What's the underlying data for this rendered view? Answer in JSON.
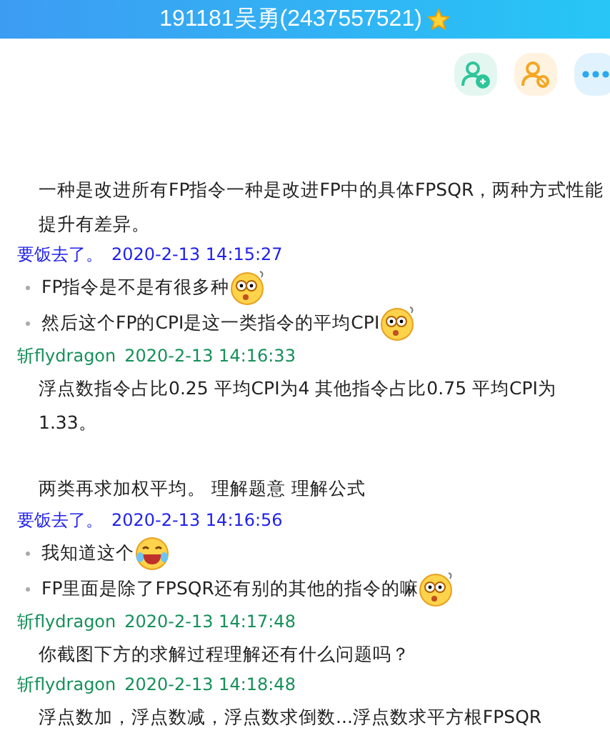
{
  "window": {
    "title": "191181吴勇(2437557521)",
    "starred": true
  },
  "toolbar": [
    {
      "kind": "add-person"
    },
    {
      "kind": "block-person"
    },
    {
      "kind": "more"
    }
  ],
  "messages": [
    {
      "lines": [
        {
          "kind": "spacer"
        },
        {
          "kind": "spacer"
        },
        {
          "kind": "text",
          "text": "一种是改进所有FP指令一种是改进FP中的具体FPSQR，两种方式性能提升有差异。"
        }
      ]
    },
    {
      "sender": "要饭去了。",
      "time": "2020-2-13 14:15:27",
      "color": "#2222ee",
      "lines": [
        {
          "kind": "bullet",
          "text": "FP指令是不是有很多种",
          "emoji": {
            "kind": "surprised"
          }
        },
        {
          "kind": "bullet",
          "text": "然后这个FP的CPI是这一类指令的平均CPI",
          "emoji": {
            "kind": "surprised"
          }
        }
      ]
    },
    {
      "sender": "斩flydragon",
      "time": "2020-2-13 14:16:33",
      "color": "#16905a",
      "lines": [
        {
          "kind": "text",
          "text": "浮点数指令占比0.25 平均CPI为4  其他指令占比0.75  平均CPI为1.33。"
        },
        {
          "kind": "spacer"
        },
        {
          "kind": "text",
          "text": "两类再求加权平均。   理解题意 理解公式"
        }
      ]
    },
    {
      "sender": "要饭去了。",
      "time": "2020-2-13 14:16:56",
      "color": "#2222ee",
      "lines": [
        {
          "kind": "bullet",
          "text": "我知道这个",
          "emoji": {
            "kind": "laughing"
          }
        },
        {
          "kind": "bullet",
          "text": "FP里面是除了FPSQR还有别的其他的指令的嘛",
          "emoji": {
            "kind": "surprised"
          }
        }
      ]
    },
    {
      "sender": "斩flydragon",
      "time": "2020-2-13 14:17:48",
      "color": "#16905a",
      "lines": [
        {
          "kind": "text",
          "text": "你截图下方的求解过程理解还有什么问题吗？"
        }
      ]
    },
    {
      "sender": "斩flydragon",
      "time": "2020-2-13 14:18:48",
      "color": "#16905a",
      "lines": [
        {
          "kind": "text",
          "text": "浮点数加，浮点数减，浮点数求倒数...浮点数求平方根FPSQR"
        }
      ]
    }
  ]
}
